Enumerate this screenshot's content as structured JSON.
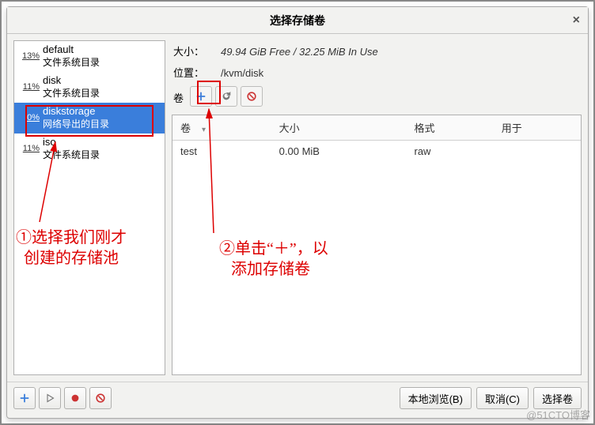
{
  "title": "选择存储卷",
  "sidebar": {
    "pools": [
      {
        "pct": "13%",
        "name": "default",
        "type": "文件系统目录"
      },
      {
        "pct": "11%",
        "name": "disk",
        "type": "文件系统目录"
      },
      {
        "pct": "0%",
        "name": "diskstorage",
        "type": "网络导出的目录"
      },
      {
        "pct": "11%",
        "name": "iso",
        "type": "文件系统目录"
      }
    ],
    "selected_index": 2
  },
  "info": {
    "size_label": "大小：",
    "size_value": "49.94 GiB Free / 32.25 MiB In Use",
    "location_label": "位置：",
    "location_value": "/kvm/disk",
    "volumes_label": "卷"
  },
  "vol_table": {
    "columns": {
      "name": "卷",
      "size": "大小",
      "format": "格式",
      "usedby": "用于"
    },
    "rows": [
      {
        "name": "test",
        "size": "0.00 MiB",
        "format": "raw",
        "usedby": ""
      }
    ]
  },
  "footer": {
    "browse": "本地浏览(B)",
    "cancel": "取消(C)",
    "choose": "选择卷"
  },
  "annotations": {
    "a1": "①选择我们刚才\n  创建的存储池",
    "a2": "②单击“＋”，以\n   添加存储卷"
  },
  "watermark": "@51CTO博客",
  "colors": {
    "accent": "#3a7edb",
    "red": "#d00000",
    "add_blue": "#3a7edb"
  }
}
